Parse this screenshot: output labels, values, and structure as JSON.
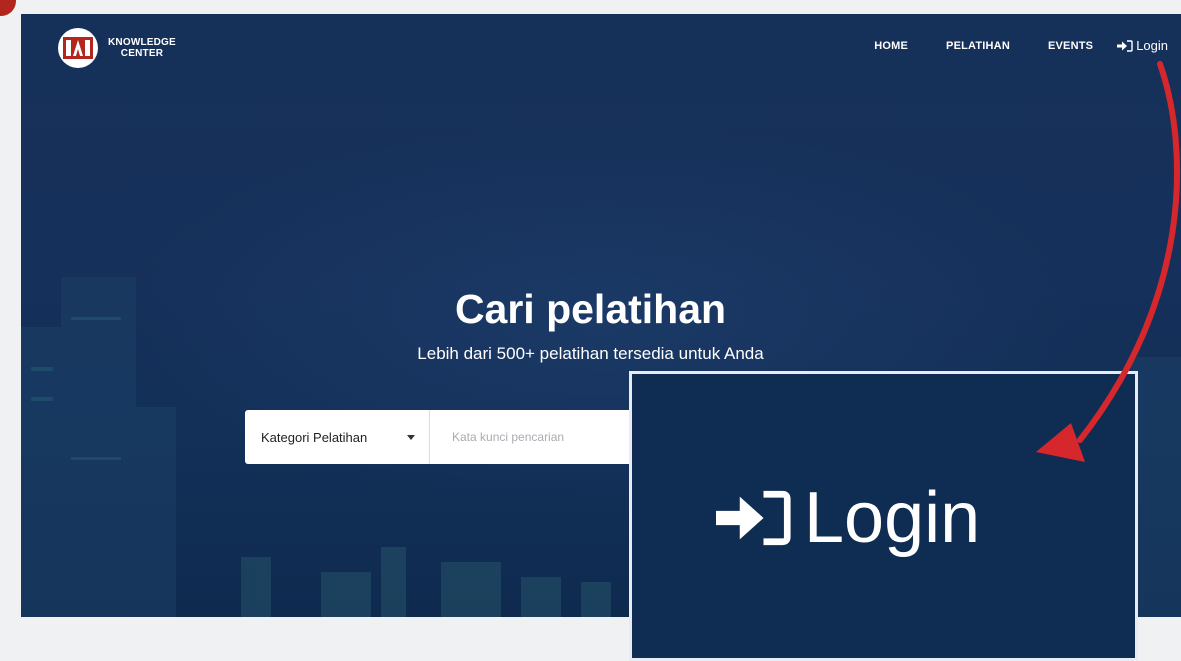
{
  "brand": {
    "line1": "KNOWLEDGE",
    "line2": "CENTER"
  },
  "nav": {
    "home": "HOME",
    "pelatihan": "PELATIHAN",
    "events": "EVENTS",
    "login": "Login"
  },
  "hero": {
    "title": "Cari pelatihan",
    "subtitle": "Lebih dari 500+ pelatihan tersedia untuk Anda"
  },
  "search": {
    "category_selected": "Kategori Pelatihan",
    "placeholder": "Kata kunci pencarian"
  },
  "callout": {
    "login": "Login"
  },
  "icons": {
    "login": "sign-in-icon",
    "dropdown": "caret-down-icon"
  },
  "colors": {
    "hero": "#15305a",
    "accent_red": "#d6282c",
    "brand_red": "#b3261e"
  }
}
